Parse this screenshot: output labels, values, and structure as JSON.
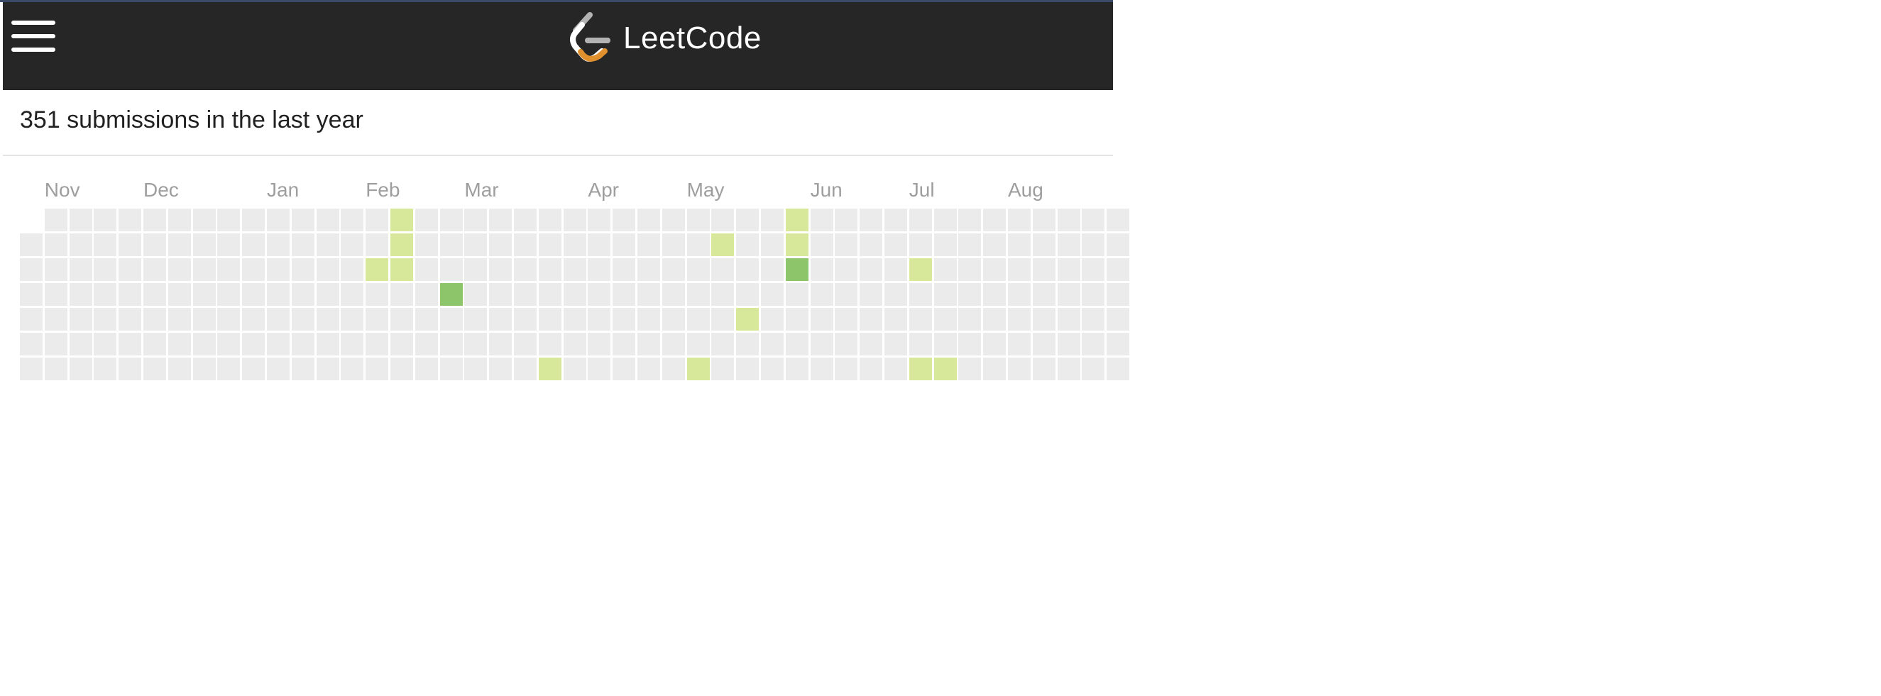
{
  "header": {
    "brand_name": "LeetCode",
    "menu_icon": "hamburger-menu-icon",
    "logo_icon": "leetcode-logo-icon",
    "background": "#262626"
  },
  "summary": {
    "text": "351 submissions in the last year"
  },
  "calendar": {
    "months": [
      {
        "label": "Nov",
        "week": 1
      },
      {
        "label": "Dec",
        "week": 5
      },
      {
        "label": "Jan",
        "week": 10
      },
      {
        "label": "Feb",
        "week": 14
      },
      {
        "label": "Mar",
        "week": 18
      },
      {
        "label": "Apr",
        "week": 23
      },
      {
        "label": "May",
        "week": 27
      },
      {
        "label": "Jun",
        "week": 32
      },
      {
        "label": "Jul",
        "week": 36
      },
      {
        "label": "Aug",
        "week": 40
      }
    ],
    "weeks_visible": 45,
    "first_week_start_day": 1,
    "level_colors": [
      "#ebebeb",
      "#d8e89b",
      "#8cc56a"
    ],
    "active_days": [
      {
        "week": 15,
        "day": 0,
        "level": 1
      },
      {
        "week": 15,
        "day": 1,
        "level": 1
      },
      {
        "week": 14,
        "day": 2,
        "level": 1
      },
      {
        "week": 15,
        "day": 2,
        "level": 1
      },
      {
        "week": 17,
        "day": 3,
        "level": 2
      },
      {
        "week": 21,
        "day": 6,
        "level": 1
      },
      {
        "week": 27,
        "day": 6,
        "level": 1
      },
      {
        "week": 28,
        "day": 1,
        "level": 1
      },
      {
        "week": 29,
        "day": 4,
        "level": 1
      },
      {
        "week": 31,
        "day": 0,
        "level": 1
      },
      {
        "week": 31,
        "day": 1,
        "level": 1
      },
      {
        "week": 31,
        "day": 2,
        "level": 2
      },
      {
        "week": 36,
        "day": 2,
        "level": 1
      },
      {
        "week": 36,
        "day": 6,
        "level": 1
      },
      {
        "week": 37,
        "day": 6,
        "level": 1
      }
    ]
  }
}
